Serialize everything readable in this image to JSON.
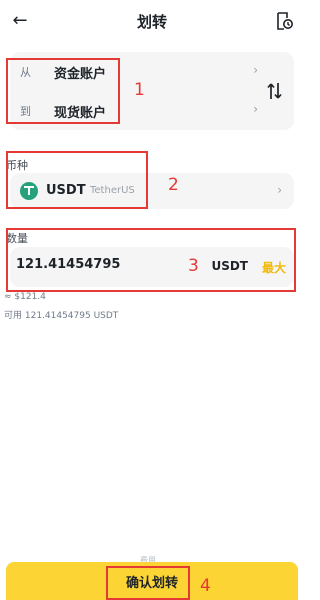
{
  "header": {
    "title": "划转",
    "back_icon": "arrow-left-icon",
    "history_icon": "order-history-icon"
  },
  "transfer": {
    "from": {
      "label": "从",
      "account": "资金账户"
    },
    "to": {
      "label": "到",
      "account": "现货账户"
    },
    "swap_icon": "swap-vertical-icon"
  },
  "coin": {
    "section_label": "币种",
    "symbol": "USDT",
    "name": "TetherUS",
    "icon_color": "#26a17b"
  },
  "amount": {
    "section_label": "数量",
    "value": "121.41454795",
    "unit": "USDT",
    "max_label": "最大",
    "approx": "≈ $121.4",
    "available": "可用 121.41454795 USDT"
  },
  "footer": {
    "hint": "费用",
    "confirm_label": "确认划转"
  },
  "annotations": [
    "1",
    "2",
    "3",
    "4"
  ],
  "colors": {
    "accent": "#fcd535",
    "max_text": "#f0b90b",
    "annotation": "#e53935",
    "card_bg": "#f5f5f5"
  }
}
